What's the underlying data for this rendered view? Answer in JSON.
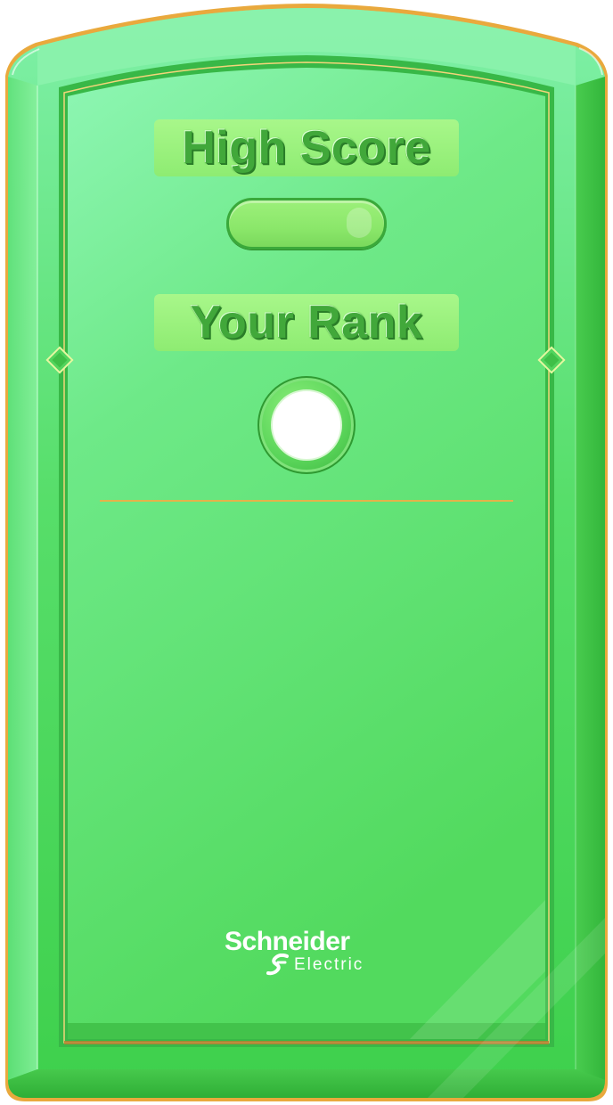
{
  "scoreboard": {
    "high_score_label": "High Score",
    "high_score_value": "",
    "rank_label": "Your Rank",
    "rank_value": ""
  },
  "brand": {
    "name_line1": "Schneider",
    "name_line2": "Electric"
  },
  "icons": {
    "diamond_left": "diamond-ornament-icon",
    "diamond_right": "diamond-ornament-icon",
    "logo_mark": "schneider-logo-icon"
  },
  "colors": {
    "panel_top": "#8ff5b4",
    "panel_mid": "#6fe97e",
    "panel_bottom": "#4fd85a",
    "frame_edge": "#2fb43a",
    "gold_trim": "#e8a93c",
    "title_text": "#41a83a",
    "title_plate": "#a2f585"
  }
}
